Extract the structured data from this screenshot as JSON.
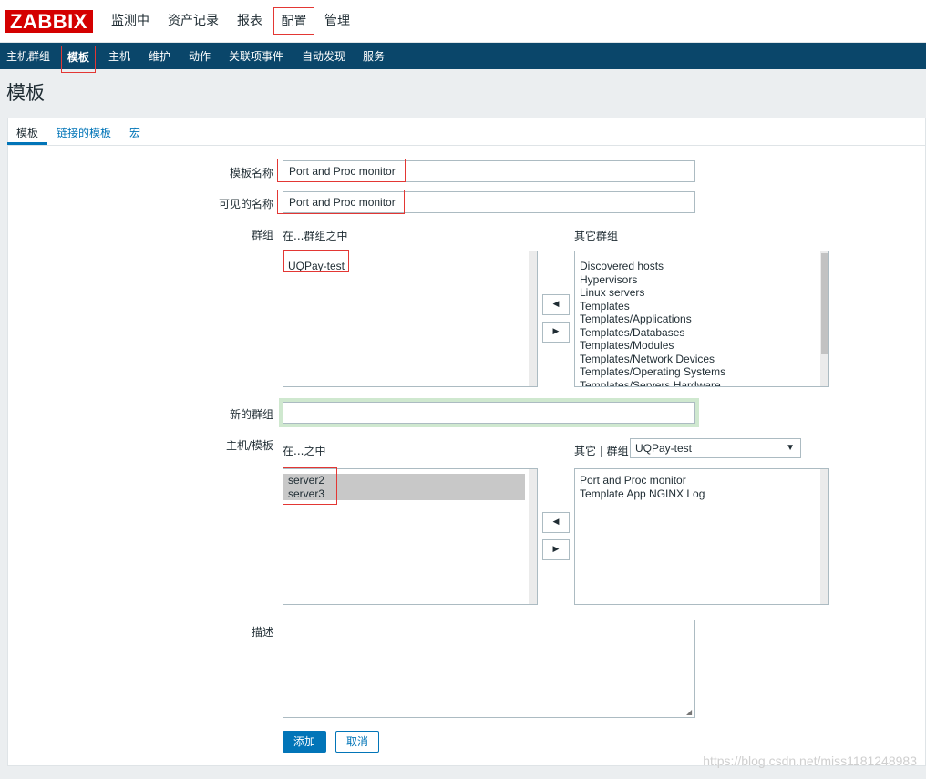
{
  "app": {
    "logo": "ZABBIX"
  },
  "topnav": [
    "监测中",
    "资产记录",
    "报表",
    "配置",
    "管理"
  ],
  "subnav": [
    "主机群组",
    "模板",
    "主机",
    "维护",
    "动作",
    "关联项事件",
    "自动发现",
    "服务"
  ],
  "page_title": "模板",
  "tabs": [
    "模板",
    "链接的模板",
    "宏"
  ],
  "form": {
    "template_name_label": "模板名称",
    "template_name_value": "Port and Proc monitor",
    "visible_name_label": "可见的名称",
    "visible_name_value": "Port and Proc monitor",
    "groups_label": "群组",
    "groups_in_label": "在...群组之中",
    "groups_other_label": "其它群组",
    "groups_in": [
      "UQPay-test"
    ],
    "groups_other": [
      "Discovered hosts",
      "Hypervisors",
      "Linux servers",
      "Templates",
      "Templates/Applications",
      "Templates/Databases",
      "Templates/Modules",
      "Templates/Network Devices",
      "Templates/Operating Systems",
      "Templates/Servers Hardware"
    ],
    "new_group_label": "新的群组",
    "new_group_value": "",
    "hosts_label": "主机/模板",
    "hosts_in_label": "在...之中",
    "hosts_other_label": "其它 | 群组",
    "hosts_group_select": "UQPay-test",
    "hosts_in": [
      "server2",
      "server3"
    ],
    "hosts_other": [
      "Port and Proc monitor",
      "Template App NGINX Log"
    ],
    "description_label": "描述",
    "description_value": "",
    "add_button": "添加",
    "cancel_button": "取消"
  },
  "icons": {
    "arrow_left": "◀",
    "arrow_right": "▶",
    "dropdown": "▼",
    "resize": "◢"
  },
  "watermark": "https://blog.csdn.net/miss1181248983",
  "colors": {
    "logo_bg": "#d40000",
    "subnav_bg": "#0a466a",
    "accent": "#0275b8",
    "highlight_border": "#e33734",
    "new_group_focus": "#cfe8cf"
  }
}
